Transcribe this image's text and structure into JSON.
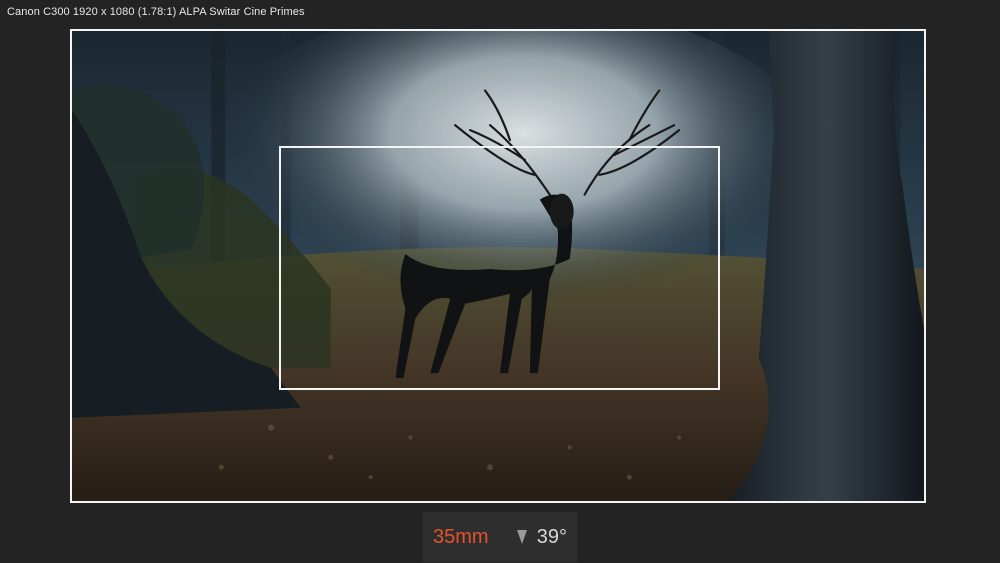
{
  "header": {
    "camera_info": "Canon C300 1920 x 1080 (1.78:1) ALPA Switar Cine Primes"
  },
  "lens": {
    "focal_length": "35mm",
    "angle_of_view": "39°",
    "angle_icon": "field-of-view-wedge-icon"
  },
  "colors": {
    "focal_accent": "#e8522b",
    "frame_line": "#f4f4f4",
    "background": "#232323"
  }
}
